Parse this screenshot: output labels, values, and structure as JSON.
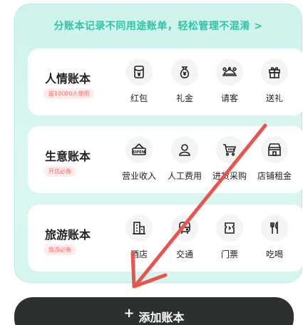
{
  "banner": "分账本记录不同用途账单，轻松管理不混淆 >",
  "cards": [
    {
      "title": "人情账本",
      "badge": "超10000人使用",
      "items": [
        {
          "label": "红包",
          "icon": "red-envelope-icon"
        },
        {
          "label": "礼金",
          "icon": "money-bag-icon"
        },
        {
          "label": "请客",
          "icon": "dining-icon"
        },
        {
          "label": "送礼",
          "icon": "gift-icon"
        }
      ]
    },
    {
      "title": "生意账本",
      "badge": "开店必备",
      "items": [
        {
          "label": "营业收入",
          "icon": "open-sign-icon"
        },
        {
          "label": "人工费用",
          "icon": "person-icon"
        },
        {
          "label": "进货采购",
          "icon": "shopping-cart-icon"
        },
        {
          "label": "店铺租金",
          "icon": "store-icon"
        }
      ]
    },
    {
      "title": "旅游账本",
      "badge": "旅游必备",
      "items": [
        {
          "label": "酒店",
          "icon": "hotel-icon"
        },
        {
          "label": "交通",
          "icon": "bus-icon"
        },
        {
          "label": "门票",
          "icon": "ticket-icon"
        },
        {
          "label": "吃喝",
          "icon": "cutlery-icon"
        }
      ]
    }
  ],
  "add_button": {
    "plus": "+",
    "label": "添加账本"
  },
  "icon_tag": "OPEN",
  "colors": {
    "accent": "#2fc4a6",
    "badge_text": "#ff6b6b",
    "arrow": "#e8554e",
    "button": "#2c3030"
  }
}
